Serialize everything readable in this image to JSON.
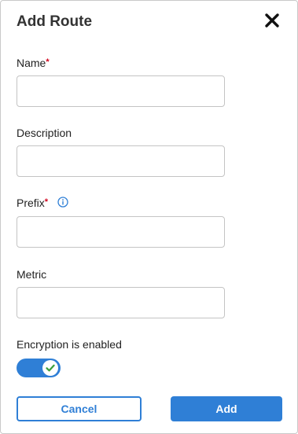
{
  "dialog": {
    "title": "Add Route"
  },
  "fields": {
    "name": {
      "label": "Name",
      "required_mark": "*",
      "value": ""
    },
    "description": {
      "label": "Description",
      "value": ""
    },
    "prefix": {
      "label": "Prefix",
      "required_mark": "*",
      "value": ""
    },
    "metric": {
      "label": "Metric",
      "value": ""
    }
  },
  "encryption": {
    "label": "Encryption is enabled",
    "enabled": true
  },
  "buttons": {
    "cancel": "Cancel",
    "add": "Add"
  },
  "colors": {
    "accent": "#2f7fd6",
    "required": "#d0021b",
    "check": "#3a9e3a",
    "info": "#2f7fd6"
  },
  "icons": {
    "close": "close-icon",
    "info": "info-icon",
    "check": "check-icon"
  }
}
